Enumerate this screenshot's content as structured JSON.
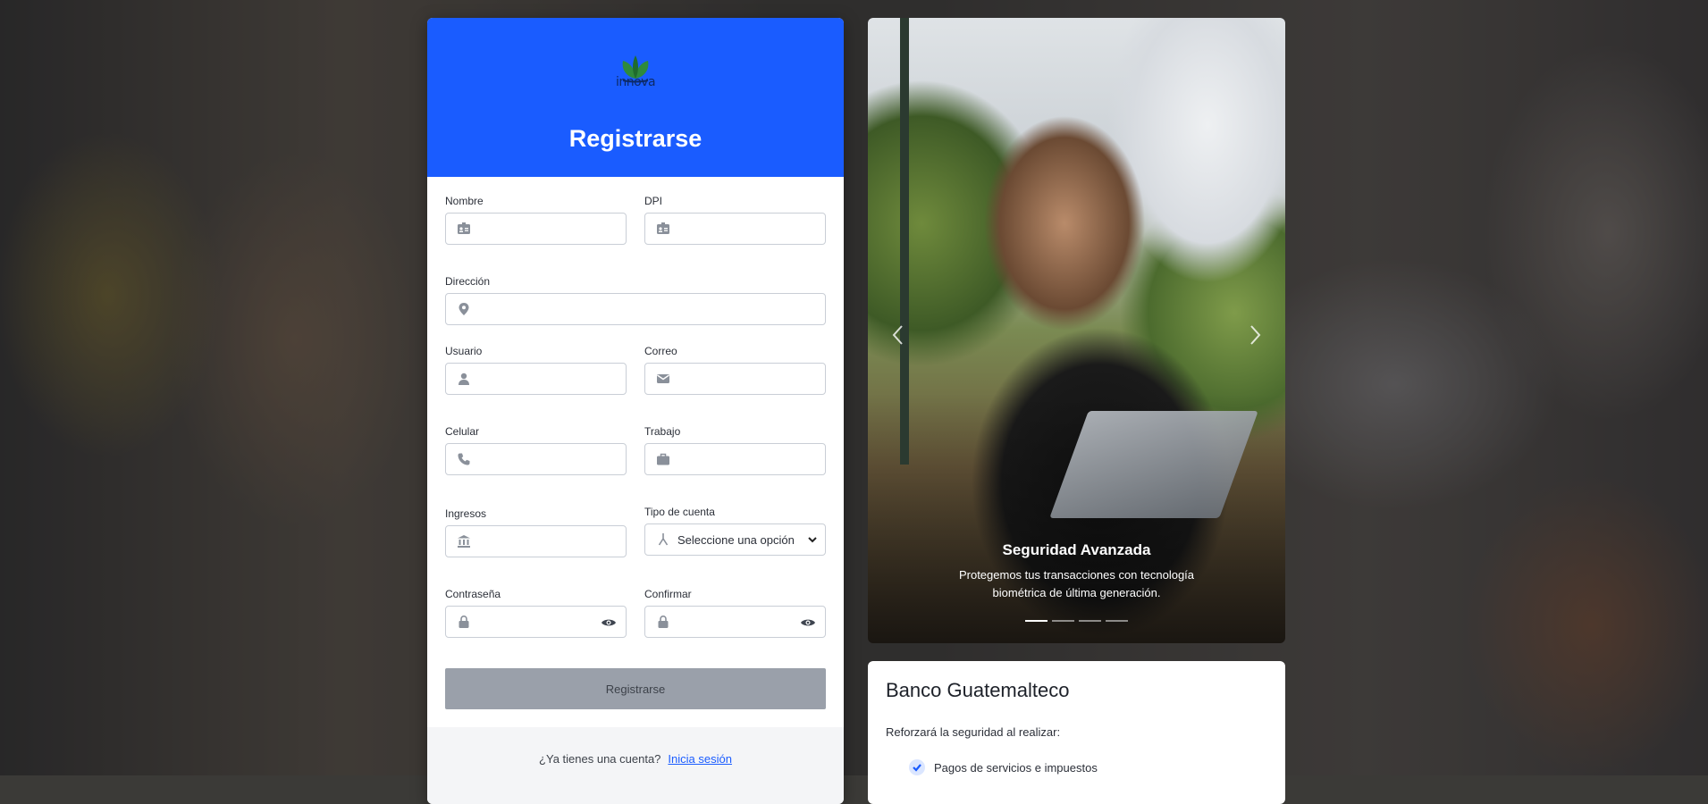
{
  "brand": {
    "logo_text": "innova",
    "accent": "#1a5cff"
  },
  "register": {
    "title": "Registrarse",
    "fields": {
      "nombre": {
        "label": "Nombre",
        "icon": "id-card-icon",
        "value": ""
      },
      "dpi": {
        "label": "DPI",
        "icon": "id-card-icon",
        "value": ""
      },
      "direccion": {
        "label": "Dirección",
        "icon": "map-pin-icon",
        "value": ""
      },
      "usuario": {
        "label": "Usuario",
        "icon": "user-icon",
        "value": ""
      },
      "correo": {
        "label": "Correo",
        "icon": "envelope-icon",
        "value": ""
      },
      "celular": {
        "label": "Celular",
        "icon": "phone-icon",
        "value": ""
      },
      "trabajo": {
        "label": "Trabajo",
        "icon": "briefcase-icon",
        "value": ""
      },
      "ingresos": {
        "label": "Ingresos",
        "icon": "bank-icon",
        "value": ""
      },
      "tipo_cuenta": {
        "label": "Tipo de cuenta",
        "icon": "fork-icon",
        "selected": "Seleccione una opción"
      },
      "contrasena": {
        "label": "Contraseña",
        "icon": "lock-icon",
        "value": ""
      },
      "confirmar": {
        "label": "Confirmar",
        "icon": "lock-icon",
        "value": ""
      }
    },
    "submit_label": "Registrarse",
    "login_prompt": "¿Ya tienes una cuenta?",
    "login_link": "Inicia sesión"
  },
  "carousel": {
    "caption_title": "Seguridad Avanzada",
    "caption_text": "Protegemos tus transacciones con tecnología biométrica de última generación.",
    "slide_count": 4,
    "active_slide": 1
  },
  "info": {
    "title": "Banco Guatemalteco",
    "lead": "Reforzará la seguridad al realizar:",
    "items": [
      "Pagos de servicios e impuestos"
    ]
  }
}
